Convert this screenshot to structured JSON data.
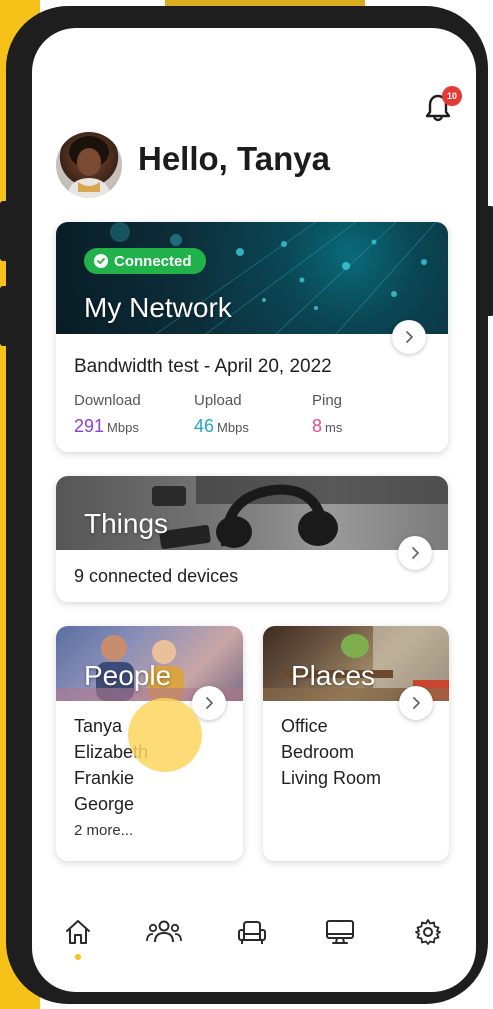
{
  "header": {
    "greeting": "Hello, Tanya",
    "notification_count": "10"
  },
  "network_card": {
    "status": "Connected",
    "title": "My Network",
    "bandwidth_label": "Bandwidth test - April 20, 2022",
    "metrics": [
      {
        "label": "Download",
        "value": "291",
        "unit": "Mbps",
        "color": "#8e3fd8"
      },
      {
        "label": "Upload",
        "value": "46",
        "unit": "Mbps",
        "color": "#23a8c7"
      },
      {
        "label": "Ping",
        "value": "8",
        "unit": "ms",
        "color": "#e54b8a"
      }
    ]
  },
  "things_card": {
    "title": "Things",
    "subtitle": "9 connected devices"
  },
  "people_card": {
    "title": "People",
    "items": [
      "Tanya",
      "Elizabeth",
      "Frankie",
      "George"
    ],
    "more": "2 more..."
  },
  "places_card": {
    "title": "Places",
    "items": [
      "Office",
      "Bedroom",
      "Living Room"
    ]
  },
  "bottom_nav": [
    {
      "icon": "home-icon",
      "active": true
    },
    {
      "icon": "people-icon",
      "active": false
    },
    {
      "icon": "armchair-icon",
      "active": false
    },
    {
      "icon": "monitor-icon",
      "active": false
    },
    {
      "icon": "gear-icon",
      "active": false
    }
  ],
  "colors": {
    "accent": "#f6c21a",
    "connected_green": "#21b24b",
    "badge_red": "#e53935"
  }
}
